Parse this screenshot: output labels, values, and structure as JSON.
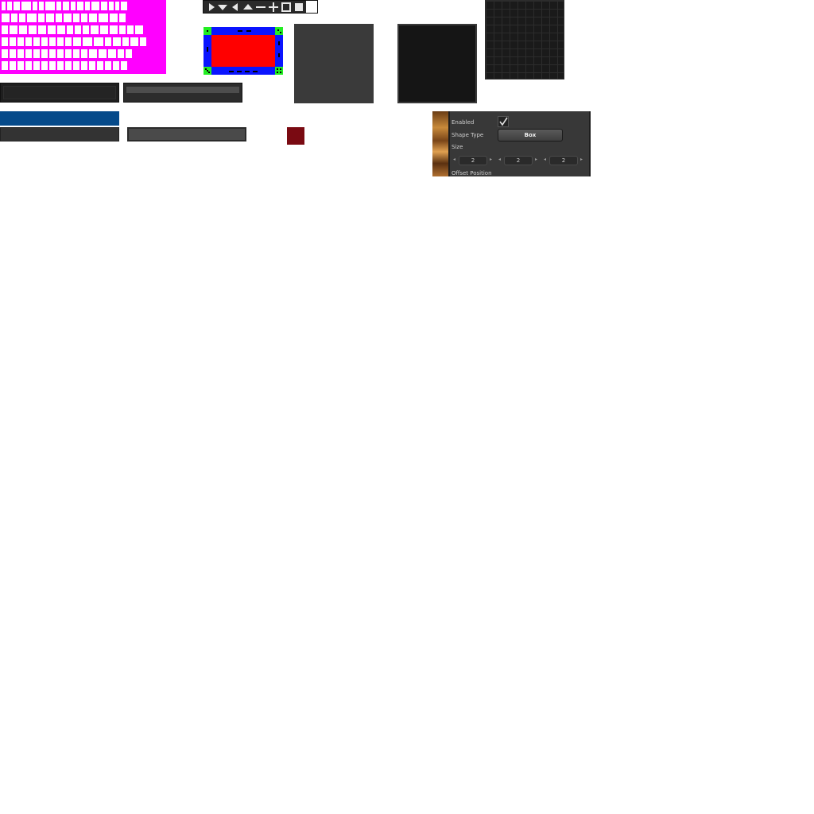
{
  "glyph_atlas": {
    "rows": [
      [
        7,
        8,
        10,
        14,
        8,
        8,
        14,
        8,
        10,
        8,
        10,
        8,
        12,
        10,
        8,
        7,
        10
      ],
      [
        12,
        10,
        10,
        14,
        10,
        12,
        10,
        12,
        10,
        10,
        12,
        14,
        12,
        10
      ],
      [
        10,
        12,
        12,
        12,
        12,
        12,
        12,
        10,
        10,
        10,
        12,
        12,
        12,
        10,
        10,
        12
      ],
      [
        10,
        10,
        10,
        10,
        10,
        10,
        10,
        10,
        10,
        12,
        14,
        14,
        10,
        12,
        10,
        12,
        10
      ],
      [
        10,
        10,
        10,
        10,
        10,
        10,
        10,
        10,
        10,
        10,
        10,
        12,
        12,
        12,
        10,
        10
      ],
      [
        10,
        10,
        10,
        10,
        10,
        10,
        10,
        10,
        10,
        10,
        10,
        10,
        10,
        10,
        10,
        10
      ]
    ]
  },
  "inspector": {
    "enabled_label": "Enabled",
    "enabled_checked": true,
    "shape_type_label": "Shape Type",
    "shape_type_value": "Box",
    "size_label": "Size",
    "size_values": [
      "2",
      "2",
      "2"
    ],
    "offset_label": "Offset Position"
  },
  "icons": [
    "play-right-icon",
    "arrow-down-icon",
    "arrow-left-icon",
    "arrow-up-icon",
    "minus-icon",
    "plus-icon",
    "square-outline-icon",
    "square-filled-icon",
    "white-square-icon"
  ],
  "colors": {
    "magenta": "#ff00ff",
    "blue_bar": "#054a8a",
    "red_swatch": "#7a0a12",
    "nine_slice_border": "#0a14ff",
    "nine_slice_center": "#ff0000",
    "nine_slice_corner": "#22ee22"
  }
}
